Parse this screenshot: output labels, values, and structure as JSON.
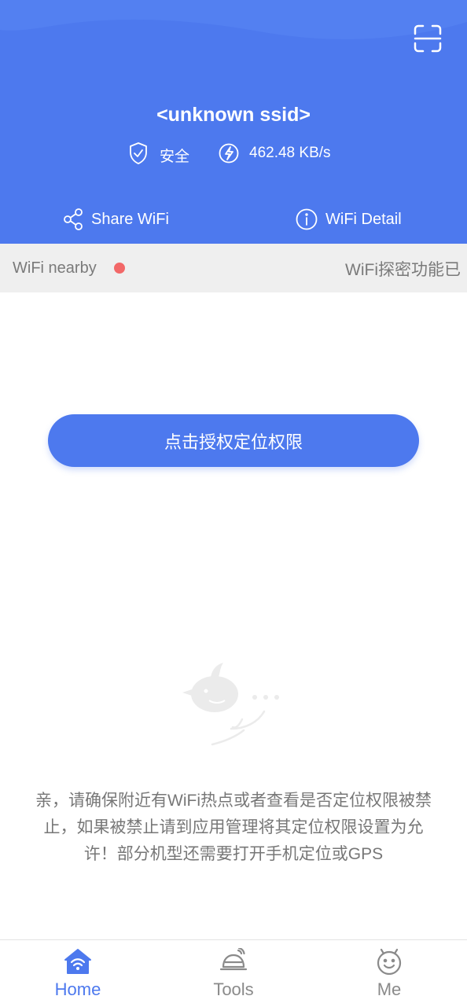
{
  "header": {
    "ssid": "<unknown ssid>",
    "security_label": "安全",
    "speed": "462.48 KB/s",
    "share_label": "Share WiFi",
    "detail_label": "WiFi Detail",
    "scan_icon": "scan-icon"
  },
  "nearby": {
    "label": "WiFi nearby",
    "marquee": "WiFi探密功能已"
  },
  "main": {
    "auth_button": "点击授权定位权限",
    "hint": "亲，请确保附近有WiFi热点或者查看是否定位权限被禁止，如果被禁止请到应用管理将其定位权限设置为允许！部分机型还需要打开手机定位或GPS"
  },
  "tabs": [
    {
      "label": "Home",
      "icon": "home-wifi-icon",
      "active": true
    },
    {
      "label": "Tools",
      "icon": "tools-icon",
      "active": false
    },
    {
      "label": "Me",
      "icon": "me-icon",
      "active": false
    }
  ],
  "colors": {
    "accent": "#4d79ee",
    "bar_bg": "#efefef",
    "dot": "#f26868",
    "muted_text": "#777777"
  }
}
